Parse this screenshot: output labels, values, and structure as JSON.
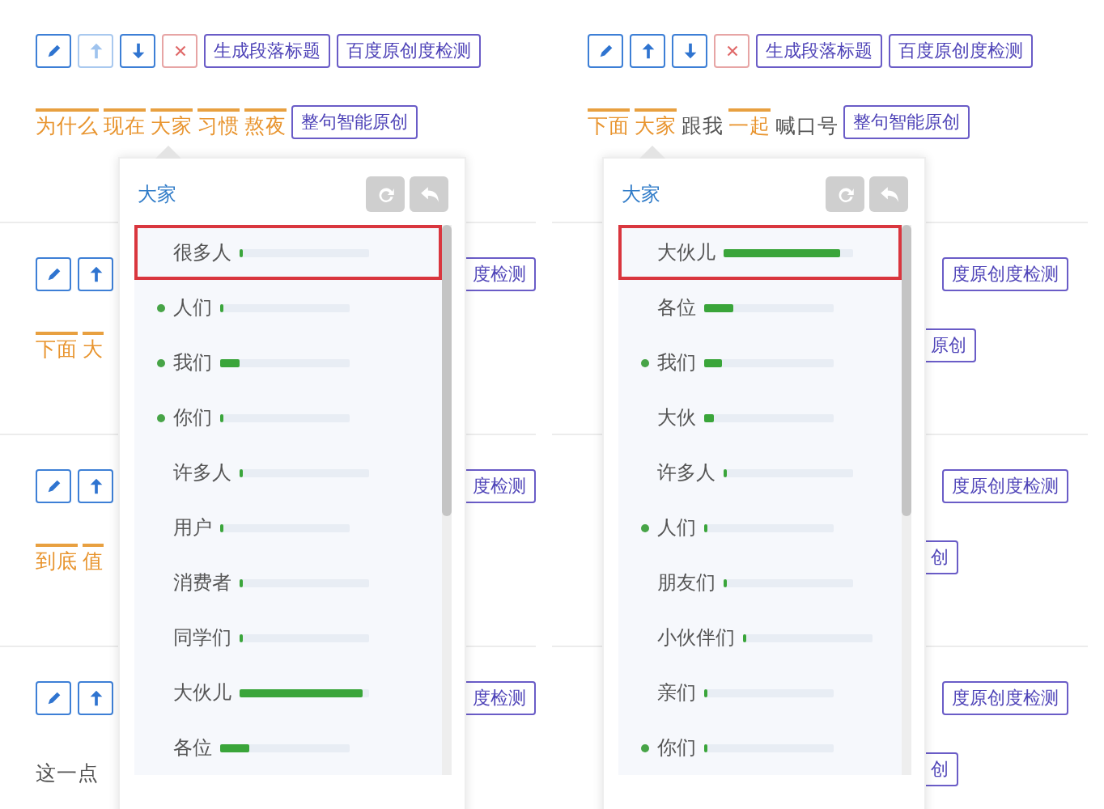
{
  "panels": [
    {
      "blocks": [
        {
          "tools": [
            {
              "kind": "edit",
              "disabled": false
            },
            {
              "kind": "up",
              "disabled": true
            },
            {
              "kind": "down",
              "disabled": false
            },
            {
              "kind": "delete",
              "disabled": false
            }
          ],
          "buttons": [
            "生成段落标题",
            "百度原创度检测"
          ],
          "words": [
            {
              "text": "为什么",
              "marked": true
            },
            {
              "text": "现在",
              "marked": true
            },
            {
              "text": "大家",
              "marked": true
            },
            {
              "text": "习惯",
              "marked": true
            },
            {
              "text": "熬夜",
              "marked": true
            }
          ],
          "rewrite": "整句智能原创"
        },
        {
          "tools": [
            {
              "kind": "edit",
              "disabled": false
            },
            {
              "kind": "up",
              "disabled": false
            }
          ],
          "tail_button": "度检测",
          "words": [
            {
              "text": "下面",
              "marked": true
            },
            {
              "text": "大",
              "marked": true
            }
          ]
        },
        {
          "tools": [
            {
              "kind": "edit",
              "disabled": false
            },
            {
              "kind": "up",
              "disabled": false
            }
          ],
          "tail_button": "度检测",
          "words": [
            {
              "text": "到底",
              "marked": true
            },
            {
              "text": "值",
              "marked": true
            }
          ]
        },
        {
          "tools": [
            {
              "kind": "edit",
              "disabled": false
            },
            {
              "kind": "up",
              "disabled": false
            }
          ],
          "tail_button": "度检测",
          "words": [
            {
              "text": "这一点",
              "marked": false
            }
          ]
        }
      ],
      "popup": {
        "word": "大家",
        "items": [
          {
            "text": "很多人",
            "recommended": false,
            "level": 0.02,
            "selected": true
          },
          {
            "text": "人们",
            "recommended": true,
            "level": 0.02,
            "selected": false
          },
          {
            "text": "我们",
            "recommended": true,
            "level": 0.15,
            "selected": false
          },
          {
            "text": "你们",
            "recommended": true,
            "level": 0.02,
            "selected": false
          },
          {
            "text": "许多人",
            "recommended": false,
            "level": 0.03,
            "selected": false
          },
          {
            "text": "用户",
            "recommended": false,
            "level": 0.02,
            "selected": false
          },
          {
            "text": "消费者",
            "recommended": false,
            "level": 0.02,
            "selected": false
          },
          {
            "text": "同学们",
            "recommended": false,
            "level": 0.02,
            "selected": false
          },
          {
            "text": "大伙儿",
            "recommended": false,
            "level": 0.95,
            "selected": false
          },
          {
            "text": "各位",
            "recommended": false,
            "level": 0.23,
            "selected": false
          }
        ]
      }
    },
    {
      "blocks": [
        {
          "tools": [
            {
              "kind": "edit",
              "disabled": false
            },
            {
              "kind": "up",
              "disabled": false
            },
            {
              "kind": "down",
              "disabled": false
            },
            {
              "kind": "delete",
              "disabled": false
            }
          ],
          "buttons": [
            "生成段落标题",
            "百度原创度检测"
          ],
          "words": [
            {
              "text": "下面",
              "marked": true
            },
            {
              "text": "大家",
              "marked": true
            },
            {
              "text": "跟我",
              "marked": false
            },
            {
              "text": "一起",
              "marked": true
            },
            {
              "text": "喊口号",
              "marked": false
            }
          ],
          "rewrite": "整句智能原创"
        },
        {
          "tail_button": "度原创度检测",
          "tail_rewrite": "原创"
        },
        {
          "tail_button": "度原创度检测",
          "tail_rewrite": "创"
        },
        {
          "tail_button": "度原创度检测",
          "tail_rewrite": "创"
        }
      ],
      "popup": {
        "word": "大家",
        "items": [
          {
            "text": "大伙儿",
            "recommended": false,
            "level": 0.9,
            "selected": true
          },
          {
            "text": "各位",
            "recommended": false,
            "level": 0.22,
            "selected": false
          },
          {
            "text": "我们",
            "recommended": true,
            "level": 0.14,
            "selected": false
          },
          {
            "text": "大伙",
            "recommended": false,
            "level": 0.08,
            "selected": false
          },
          {
            "text": "许多人",
            "recommended": false,
            "level": 0.03,
            "selected": false
          },
          {
            "text": "人们",
            "recommended": true,
            "level": 0.02,
            "selected": false
          },
          {
            "text": "朋友们",
            "recommended": false,
            "level": 0.03,
            "selected": false
          },
          {
            "text": "小伙伴们",
            "recommended": false,
            "level": 0.03,
            "selected": false
          },
          {
            "text": "亲们",
            "recommended": false,
            "level": 0.03,
            "selected": false
          },
          {
            "text": "你们",
            "recommended": true,
            "level": 0.02,
            "selected": false
          }
        ]
      }
    }
  ]
}
